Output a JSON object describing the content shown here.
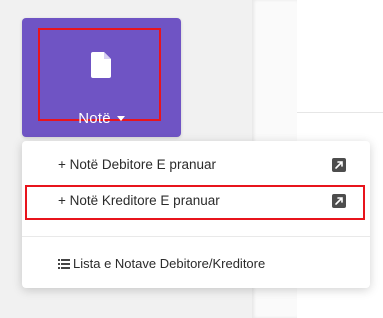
{
  "note_button": {
    "label": "Notë",
    "icon": "document-icon",
    "caret_icon": "caret-down-icon",
    "color": "#6f54c4",
    "highlight_color": "#e8141c"
  },
  "dropdown": {
    "items": [
      {
        "label": "+ Notë Debitore E pranuar",
        "icon": "external-link-icon"
      },
      {
        "label": "+ Notë Kreditore E pranuar",
        "icon": "external-link-icon",
        "highlighted": true
      },
      {
        "label": "Lista e Notave Debitore/Kreditore",
        "icon": "list-icon"
      }
    ]
  }
}
